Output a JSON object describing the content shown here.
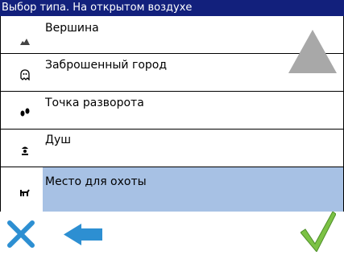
{
  "window": {
    "title": "Выбор типа. На открытом воздухе"
  },
  "list": {
    "items": [
      {
        "label": "Вершина",
        "icon": "summit-icon"
      },
      {
        "label": "Заброшенный город",
        "icon": "ghost-town-icon"
      },
      {
        "label": "Точка разворота",
        "icon": "trailhead-icon"
      },
      {
        "label": "Душ",
        "icon": "shower-icon"
      },
      {
        "label": "Место для охоты",
        "icon": "hunting-icon",
        "selected": true
      }
    ],
    "scroll_up_icon": "scroll-up-arrow-icon"
  },
  "toolbar": {
    "cancel_icon": "close-icon",
    "back_icon": "back-arrow-icon",
    "ok_icon": "checkmark-icon"
  },
  "colors": {
    "title_bar": "#12207c",
    "selection": "#a7c1e4",
    "cancel": "#2d8fd2",
    "back": "#2d8fd2",
    "ok": "#7cc245",
    "scroll_arrow": "#a8a8a8"
  }
}
